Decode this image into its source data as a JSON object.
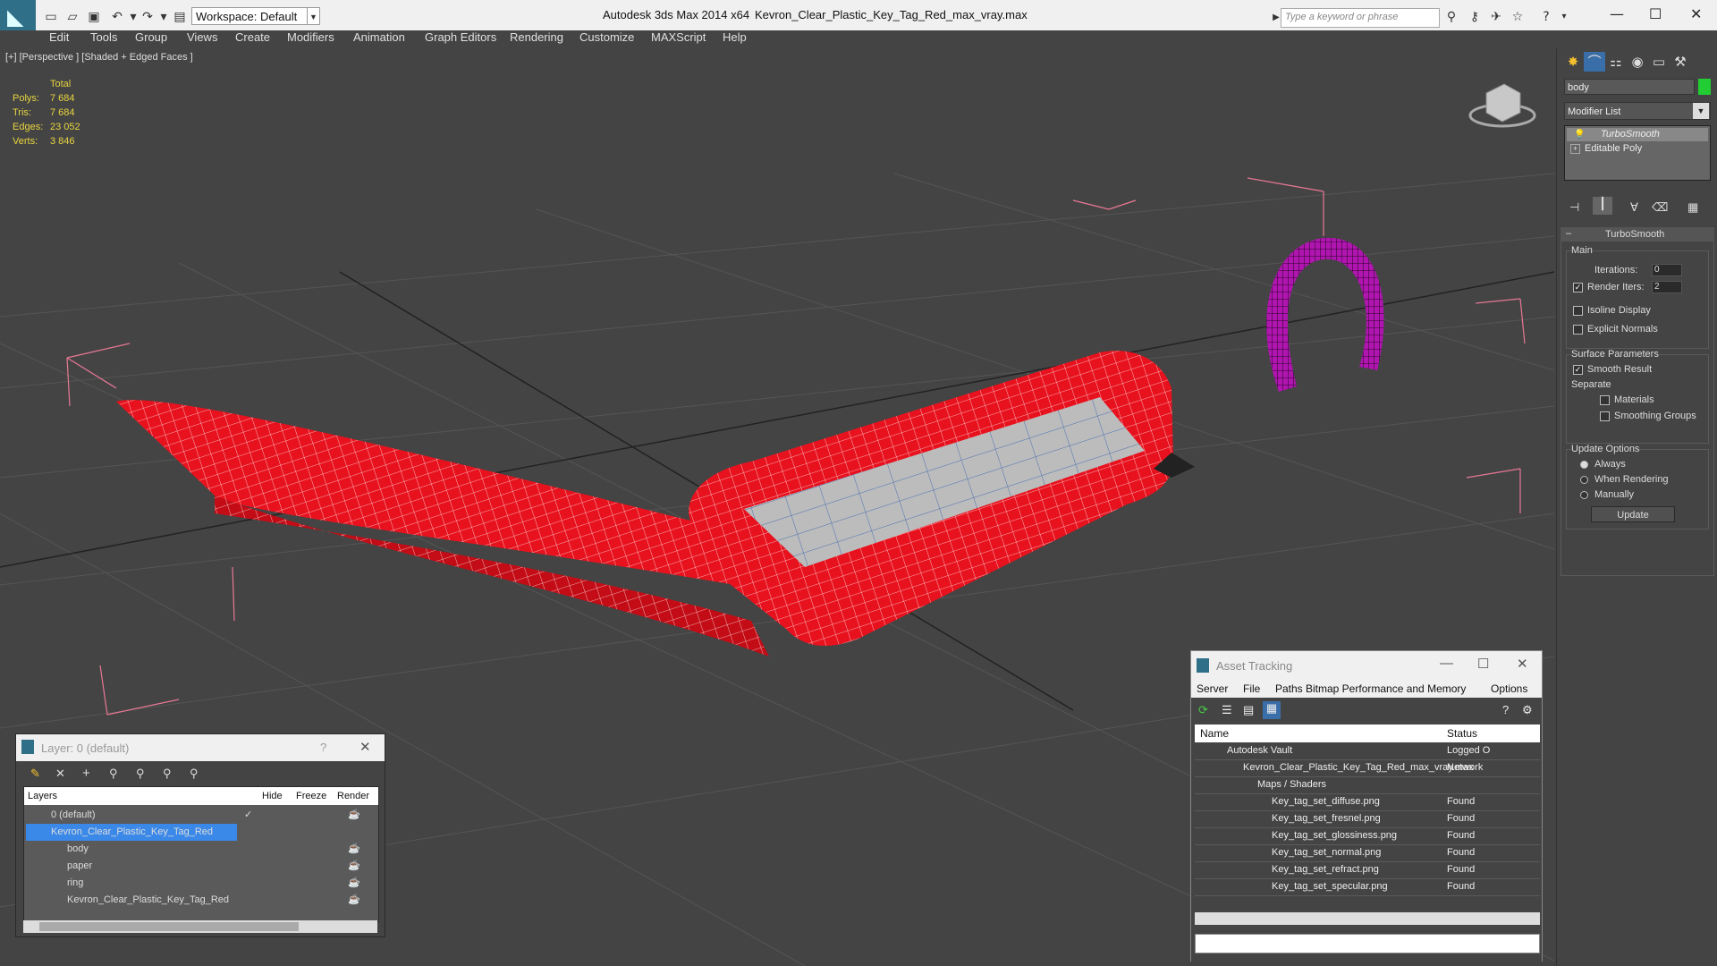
{
  "title_bar": {
    "workspace": "Workspace: Default",
    "app_title": "Autodesk 3ds Max  2014 x64",
    "file_title": "Kevron_Clear_Plastic_Key_Tag_Red_max_vray.max",
    "search_placeholder": "Type a keyword or phrase"
  },
  "menu": [
    "Edit",
    "Tools",
    "Group",
    "Views",
    "Create",
    "Modifiers",
    "Animation",
    "Graph Editors",
    "Rendering",
    "Customize",
    "MAXScript",
    "Help"
  ],
  "viewport": {
    "label": "[+] [Perspective ] [Shaded + Edged Faces ]",
    "stats": {
      "header": "Total",
      "rows": [
        {
          "label": "Polys:",
          "value": "7 684"
        },
        {
          "label": "Tris:",
          "value": "7 684"
        },
        {
          "label": "Edges:",
          "value": "23 052"
        },
        {
          "label": "Verts:",
          "value": "3 846"
        }
      ]
    }
  },
  "command_panel": {
    "object_name": "body",
    "object_color": "#22cc33",
    "modifier_list": "Modifier List",
    "stack": [
      "TurboSmooth",
      "Editable Poly"
    ],
    "rollout_title": "TurboSmooth",
    "main_label": "Main",
    "iterations_label": "Iterations:",
    "iterations_value": "0",
    "render_iters_label": "Render Iters:",
    "render_iters_value": "2",
    "isoline_label": "Isoline Display",
    "explicit_label": "Explicit Normals",
    "surface_label": "Surface Parameters",
    "smooth_result_label": "Smooth Result",
    "separate_label": "Separate",
    "materials_label": "Materials",
    "smoothing_groups_label": "Smoothing Groups",
    "update_options_label": "Update Options",
    "always_label": "Always",
    "when_rendering_label": "When Rendering",
    "manually_label": "Manually",
    "update_button": "Update"
  },
  "layer_dialog": {
    "title": "Layer: 0 (default)",
    "help": "?",
    "columns": [
      "Layers",
      "Hide",
      "Freeze",
      "Render"
    ],
    "rows": [
      {
        "name": "0 (default)",
        "indent": 1
      },
      {
        "name": "Kevron_Clear_Plastic_Key_Tag_Red",
        "indent": 1,
        "selected": true
      },
      {
        "name": "body",
        "indent": 2
      },
      {
        "name": "paper",
        "indent": 2
      },
      {
        "name": "ring",
        "indent": 2
      },
      {
        "name": "Kevron_Clear_Plastic_Key_Tag_Red",
        "indent": 2
      }
    ]
  },
  "asset_dialog": {
    "title": "Asset Tracking",
    "menu": [
      "Server",
      "File",
      "Paths",
      "Bitmap Performance and Memory",
      "Options"
    ],
    "columns": [
      "Name",
      "Status"
    ],
    "rows": [
      {
        "name": "Autodesk Vault",
        "status": "Logged O",
        "indent": 1
      },
      {
        "name": "Kevron_Clear_Plastic_Key_Tag_Red_max_vray.max",
        "status": "Network",
        "indent": 2
      },
      {
        "name": "Maps / Shaders",
        "status": "",
        "indent": 3
      },
      {
        "name": "Key_tag_set_diffuse.png",
        "status": "Found",
        "indent": 4
      },
      {
        "name": "Key_tag_set_fresnel.png",
        "status": "Found",
        "indent": 4
      },
      {
        "name": "Key_tag_set_glossiness.png",
        "status": "Found",
        "indent": 4
      },
      {
        "name": "Key_tag_set_normal.png",
        "status": "Found",
        "indent": 4
      },
      {
        "name": "Key_tag_set_refract.png",
        "status": "Found",
        "indent": 4
      },
      {
        "name": "Key_tag_set_specular.png",
        "status": "Found",
        "indent": 4
      }
    ]
  }
}
